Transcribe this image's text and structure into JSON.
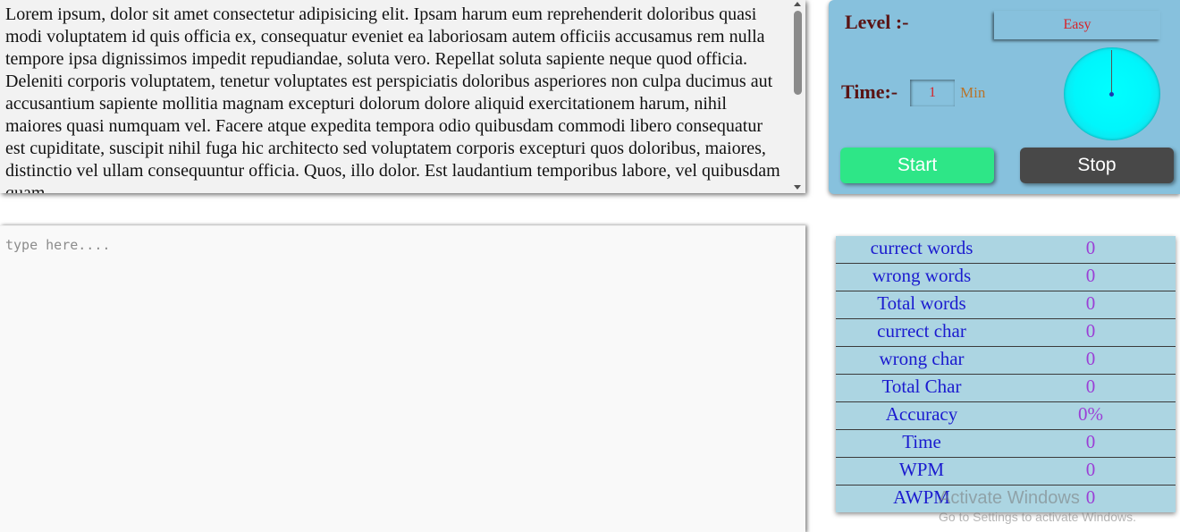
{
  "passage": {
    "text": "Lorem ipsum, dolor sit amet consectetur adipisicing elit. Ipsam harum eum reprehenderit doloribus quasi modi voluptatem id quis officia ex, consequatur eveniet ea laboriosam autem officiis accusamus rem nulla tempore ipsa dignissimos impedit repudiandae, soluta vero. Repellat soluta sapiente neque quod officia. Deleniti corporis voluptatem, tenetur voluptates est perspiciatis doloribus asperiores non culpa ducimus aut accusantium sapiente mollitia magnam excepturi dolorum dolore aliquid exercitationem harum, nihil maiores quasi numquam vel. Facere atque expedita tempora odio quibusdam commodi libero consequatur est cupiditate, suscipit nihil fuga hic architecto sed voluptatem corporis excepturi quos doloribus, maiores, distinctio vel ullam consequuntur officia. Quos, illo dolor. Est laudantium temporibus labore, vel quibusdam quam."
  },
  "controls": {
    "level_label": "Level :-",
    "level_value": "Easy",
    "time_label": "Time:-",
    "time_value": "1",
    "time_unit": "Min",
    "start_label": "Start",
    "stop_label": "Stop"
  },
  "typing": {
    "placeholder": "type here...."
  },
  "stats": [
    {
      "label": "currect words",
      "value": "0"
    },
    {
      "label": "wrong words",
      "value": "0"
    },
    {
      "label": "Total words",
      "value": "0"
    },
    {
      "label": "currect char",
      "value": "0"
    },
    {
      "label": "wrong char",
      "value": "0"
    },
    {
      "label": "Total Char",
      "value": "0"
    },
    {
      "label": "Accuracy",
      "value": "0%"
    },
    {
      "label": "Time",
      "value": "0"
    },
    {
      "label": "WPM",
      "value": "0"
    },
    {
      "label": "AWPM",
      "value": "0"
    }
  ],
  "watermark": {
    "title": "Activate Windows",
    "subtitle": "Go to Settings to activate Windows."
  },
  "colors": {
    "panel_bg": "#87c1dd",
    "start_button": "#2ee687",
    "stop_button": "#484848",
    "level_text": "#d6242a",
    "stat_label": "#1b1bcf",
    "stat_value": "#9b3fd6",
    "dial": "#00ffff"
  }
}
